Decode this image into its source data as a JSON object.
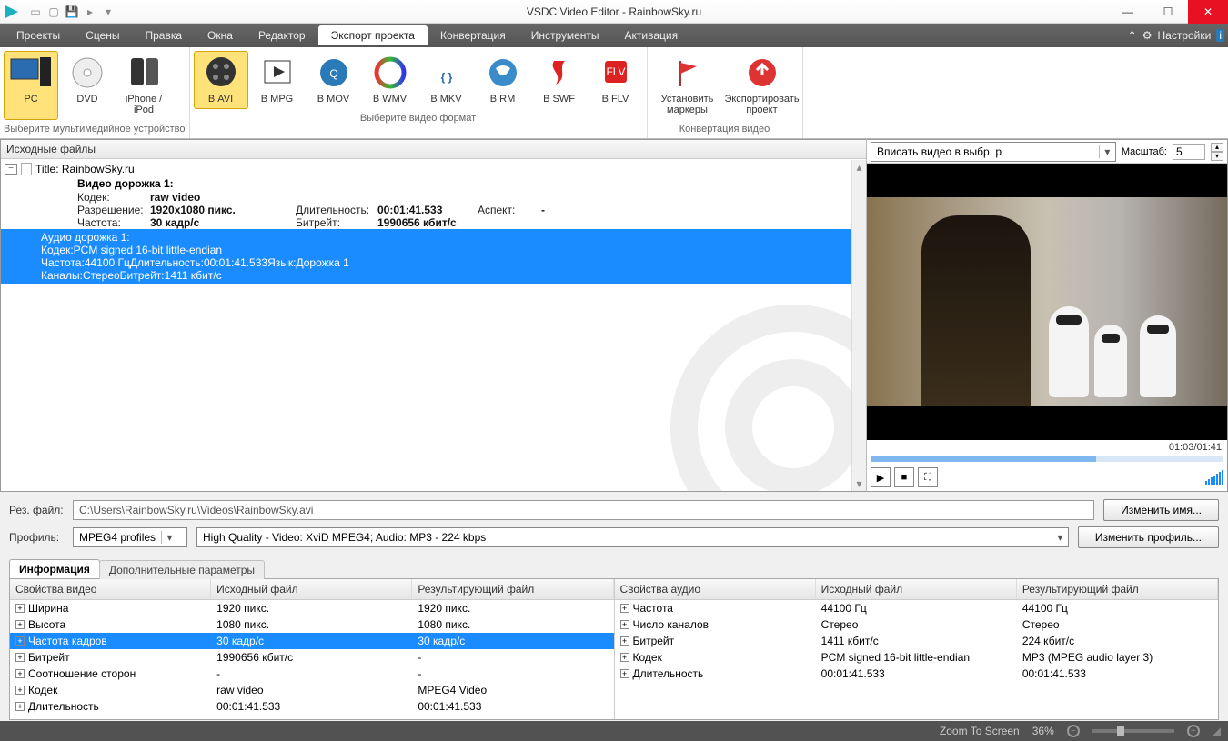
{
  "window": {
    "title": "VSDC Video Editor - RainbowSky.ru"
  },
  "menu": {
    "items": [
      "Проекты",
      "Сцены",
      "Правка",
      "Окна",
      "Редактор",
      "Экспорт проекта",
      "Конвертация",
      "Инструменты",
      "Активация"
    ],
    "active_index": 5,
    "settings_label": "Настройки"
  },
  "ribbon": {
    "groups": [
      {
        "title": "Выберите мультимедийное устройство",
        "buttons": [
          {
            "label": "PC",
            "icon": "pc",
            "sel": true
          },
          {
            "label": "DVD",
            "icon": "dvd"
          },
          {
            "label": "iPhone / iPod",
            "icon": "iphone"
          }
        ]
      },
      {
        "title": "Выберите видео формат",
        "buttons": [
          {
            "label": "В AVI",
            "icon": "avi",
            "sel": true
          },
          {
            "label": "В MPG",
            "icon": "mpg"
          },
          {
            "label": "В MOV",
            "icon": "mov"
          },
          {
            "label": "В WMV",
            "icon": "wmv"
          },
          {
            "label": "В MKV",
            "icon": "mkv"
          },
          {
            "label": "В RM",
            "icon": "rm"
          },
          {
            "label": "В SWF",
            "icon": "swf"
          },
          {
            "label": "В FLV",
            "icon": "flv"
          }
        ]
      },
      {
        "title": "Конвертация видео",
        "buttons": [
          {
            "label": "Установить маркеры",
            "icon": "flag"
          },
          {
            "label": "Экспортировать проект",
            "icon": "export"
          }
        ]
      }
    ]
  },
  "source": {
    "header": "Исходные файлы",
    "title_label": "Title: RainbowSky.ru",
    "video": {
      "heading": "Видео дорожка 1:",
      "rows": [
        [
          "Кодек:",
          "raw video",
          "",
          "",
          "",
          ""
        ],
        [
          "Разрешение:",
          "1920x1080 пикс.",
          "Длительность:",
          "00:01:41.533",
          "Аспект:",
          "-"
        ],
        [
          "Частота:",
          "30 кадр/с",
          "Битрейт:",
          "1990656 кбит/с",
          "",
          ""
        ]
      ]
    },
    "audio": {
      "heading": "Аудио дорожка 1:",
      "rows": [
        [
          "Кодек:",
          "PCM signed 16-bit little-endian",
          "",
          "",
          "",
          ""
        ],
        [
          "Частота:",
          "44100 Гц",
          "Длительность:",
          "00:01:41.533",
          "Язык:",
          "Дорожка 1"
        ],
        [
          "Каналы:",
          "Стерео",
          "Битрейт:",
          "1411 кбит/с",
          "",
          ""
        ]
      ]
    }
  },
  "preview": {
    "fit_label": "Вписать видео в выбр. р",
    "zoom_label": "Масштаб:",
    "zoom_value": "5",
    "time": "01:03/01:41"
  },
  "config": {
    "result_label": "Рез. файл:",
    "result_path": "C:\\Users\\RainbowSky.ru\\Videos\\RainbowSky.avi",
    "change_name": "Изменить имя...",
    "profile_label": "Профиль:",
    "profile": "MPEG4 profiles",
    "quality": "High Quality - Video: XviD MPEG4; Audio: MP3 - 224 kbps",
    "change_profile": "Изменить профиль..."
  },
  "tabs": {
    "info": "Информация",
    "extra": "Дополнительные параметры"
  },
  "props": {
    "video": {
      "headers": [
        "Свойства видео",
        "Исходный файл",
        "Результирующий файл"
      ],
      "rows": [
        [
          "Ширина",
          "1920 пикс.",
          "1920 пикс."
        ],
        [
          "Высота",
          "1080 пикс.",
          "1080 пикс."
        ],
        [
          "Частота кадров",
          "30 кадр/c",
          "30 кадр/c"
        ],
        [
          "Битрейт",
          "1990656 кбит/с",
          "-"
        ],
        [
          "Соотношение сторон",
          "-",
          "-"
        ],
        [
          "Кодек",
          "raw video",
          "MPEG4 Video"
        ],
        [
          "Длительность",
          "00:01:41.533",
          "00:01:41.533"
        ]
      ],
      "selected_index": 2
    },
    "audio": {
      "headers": [
        "Свойства аудио",
        "Исходный файл",
        "Результирующий файл"
      ],
      "rows": [
        [
          "Частота",
          "44100 Гц",
          "44100 Гц"
        ],
        [
          "Число каналов",
          "Стерео",
          "Стерео"
        ],
        [
          "Битрейт",
          "1411 кбит/c",
          "224 кбит/c"
        ],
        [
          "Кодек",
          "PCM signed 16-bit little-endian",
          "MP3 (MPEG audio layer 3)"
        ],
        [
          "Длительность",
          "00:01:41.533",
          "00:01:41.533"
        ]
      ]
    }
  },
  "status": {
    "zoom_label": "Zoom To Screen",
    "zoom_pct": "36%"
  }
}
